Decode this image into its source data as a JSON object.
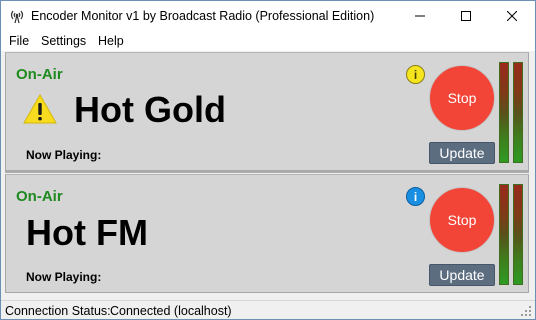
{
  "window": {
    "title": "Encoder Monitor v1 by Broadcast Radio (Professional Edition)",
    "app_icon": "antenna-broadcast-icon",
    "controls": {
      "minimize": "minimize-icon",
      "maximize": "maximize-icon",
      "close": "close-icon"
    }
  },
  "menu": {
    "file": "File",
    "settings": "Settings",
    "help": "Help"
  },
  "encoders": [
    {
      "status": "On-Air",
      "station": "Hot Gold",
      "now_playing_label": "Now Playing:",
      "alert_icon": "warning-icon",
      "info_icon": "info-icon",
      "info_icon_color": "#f5e51f",
      "stop_label": "Stop",
      "update_label": "Update"
    },
    {
      "status": "On-Air",
      "station": "Hot FM",
      "now_playing_label": "Now Playing:",
      "info_icon": "info-icon",
      "info_icon_color": "#1a8ee0",
      "stop_label": "Stop",
      "update_label": "Update"
    }
  ],
  "colors": {
    "on_air": "#1f8a1f",
    "stop_button": "#f24537",
    "update_button": "#5c6d80"
  },
  "status_bar": {
    "label": "Connection Status:",
    "value": "Connected (localhost)"
  }
}
